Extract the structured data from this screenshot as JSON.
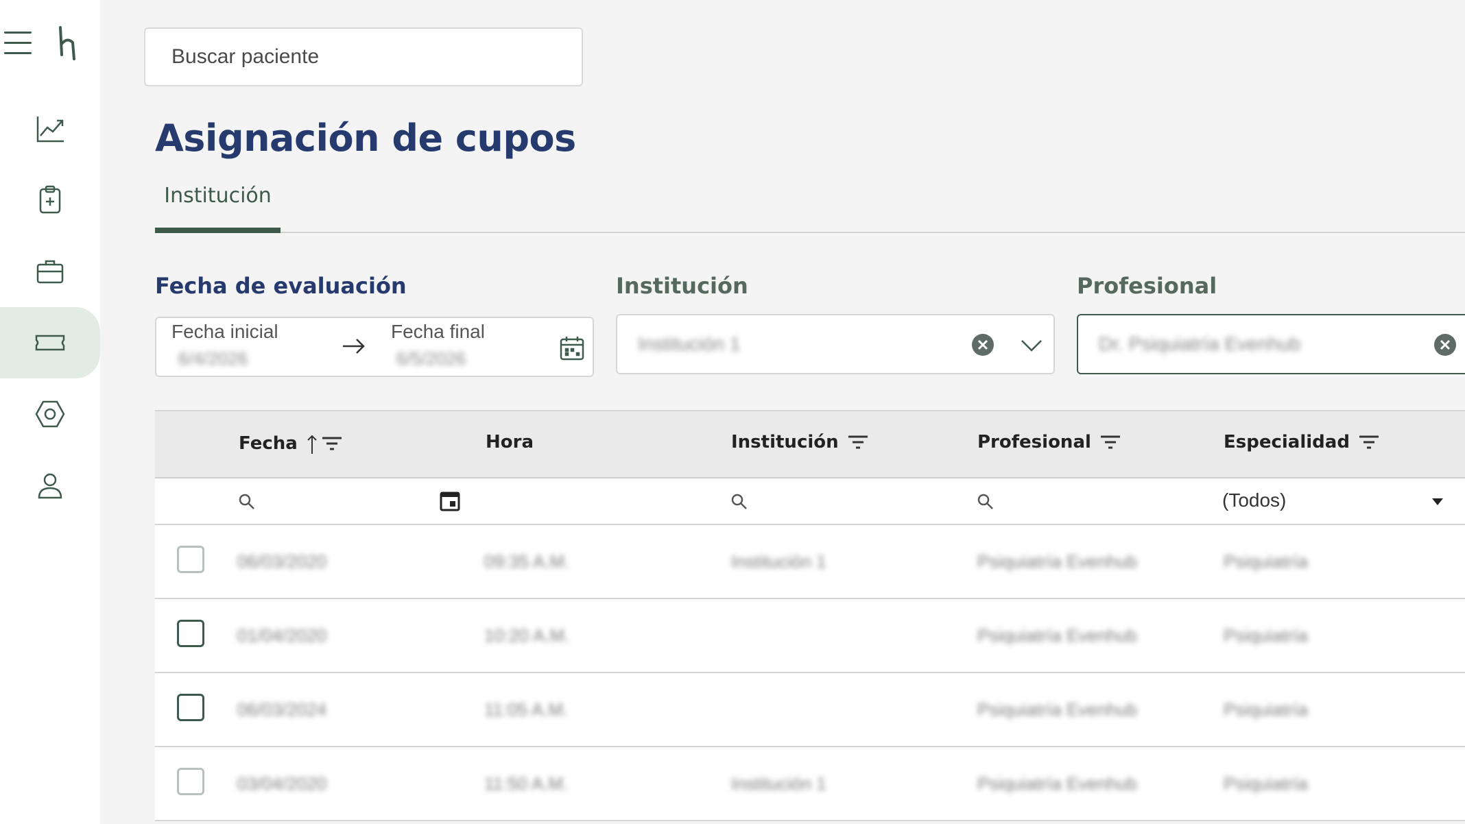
{
  "sidebar": {
    "logo": "h",
    "items": [
      {
        "icon": "chart-line-icon",
        "active": false
      },
      {
        "icon": "clipboard-plus-icon",
        "active": false
      },
      {
        "icon": "briefcase-icon",
        "active": false
      },
      {
        "icon": "ticket-icon",
        "active": true
      },
      {
        "icon": "settings-hexagon-icon",
        "active": false
      },
      {
        "icon": "user-icon",
        "active": false
      }
    ]
  },
  "search": {
    "placeholder": "Buscar paciente"
  },
  "page": {
    "title": "Asignación de cupos"
  },
  "tabs": [
    {
      "label": "Institución",
      "active": true
    }
  ],
  "filters": {
    "fecha_label": "Fecha de evaluación",
    "fecha_inicial_label": "Fecha inicial",
    "fecha_inicial_value": "6/4/2026",
    "fecha_final_label": "Fecha final",
    "fecha_final_value": "6/5/2026",
    "institucion_label": "Institución",
    "institucion_value": "Institución 1",
    "profesional_label": "Profesional",
    "profesional_value": "Dr. Psiquiatría Evenhub"
  },
  "grid": {
    "columns": [
      "Fecha",
      "Hora",
      "Institución",
      "Profesional",
      "Especialidad"
    ],
    "especialidad_filter": "(Todos)",
    "rows": [
      {
        "fecha": "06/03/2020",
        "hora": "09:35 A.M.",
        "institucion": "Institución 1",
        "profesional": "Psiquiatría Evenhub",
        "especialidad": "Psiquiatría"
      },
      {
        "fecha": "01/04/2020",
        "hora": "10:20 A.M.",
        "institucion": "",
        "profesional": "Psiquiatría Evenhub",
        "especialidad": "Psiquiatría"
      },
      {
        "fecha": "06/03/2024",
        "hora": "11:05 A.M.",
        "institucion": "",
        "profesional": "Psiquiatría Evenhub",
        "especialidad": "Psiquiatría"
      },
      {
        "fecha": "03/04/2020",
        "hora": "11:50 A.M.",
        "institucion": "Institución 1",
        "profesional": "Psiquiatría Evenhub",
        "especialidad": "Psiquiatría"
      }
    ]
  },
  "colors": {
    "primary": "#3d5a4c",
    "title": "#273a6e",
    "active_nav": "#e2ebe4"
  }
}
